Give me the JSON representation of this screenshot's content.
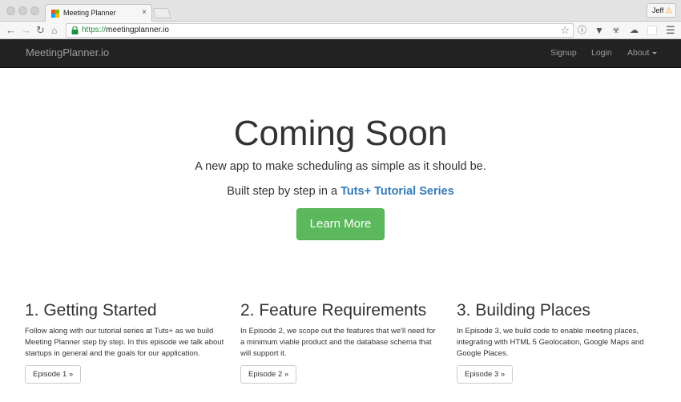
{
  "browser": {
    "tab_title": "Meeting Planner",
    "tab_close": "×",
    "profile_name": "Jeff",
    "profile_warn": "⚠",
    "url_scheme": "https://",
    "url_host": "meetingplanner.io"
  },
  "navbar": {
    "brand": "MeetingPlanner.io",
    "links": [
      "Signup",
      "Login",
      "About"
    ]
  },
  "hero": {
    "title": "Coming Soon",
    "lead": "A new app to make scheduling as simple as it should be.",
    "series_prefix": "Built step by step in a ",
    "series_link": "Tuts+ Tutorial Series",
    "button": "Learn More"
  },
  "columns": [
    {
      "title": "1. Getting Started",
      "text": "Follow along with our tutorial series at Tuts+ as we build Meeting Planner step by step. In this episode we talk about startups in general and the goals for our application.",
      "button": "Episode 1 »"
    },
    {
      "title": "2. Feature Requirements",
      "text": "In Episode 2, we scope out the features that we'll need for a minimum viable product and the database schema that will support it.",
      "button": "Episode 2 »"
    },
    {
      "title": "3. Building Places",
      "text": "In Episode 3, we build code to enable meeting places, integrating with HTML 5 Geolocation, Google Maps and Google Places.",
      "button": "Episode 3 »"
    }
  ],
  "colors": {
    "navbar_bg": "#222222",
    "navbar_text": "#9d9d9d",
    "link_blue": "#337ab7",
    "button_green": "#5cb85c",
    "secure_green": "#1e8e3e"
  },
  "icons": [
    "back-arrow-icon",
    "forward-arrow-icon",
    "reload-icon",
    "home-icon",
    "lock-icon",
    "star-icon",
    "info-icon",
    "pocket-icon",
    "extension-icons",
    "menu-icon",
    "warning-icon"
  ]
}
